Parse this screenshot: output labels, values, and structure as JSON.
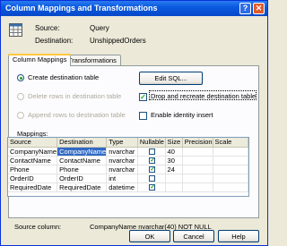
{
  "window": {
    "title": "Column Mappings and Transformations",
    "help_glyph": "?",
    "close_glyph": "✕"
  },
  "header": {
    "source_label": "Source:",
    "source_value": "Query",
    "destination_label": "Destination:",
    "destination_value": "UnshippedOrders"
  },
  "tabs": [
    {
      "label": "Column Mappings",
      "active": true
    },
    {
      "label": "Transformations",
      "active": false
    }
  ],
  "options": {
    "create_dest": "Create destination table",
    "delete_rows": "Delete rows in destination table",
    "append_rows": "Append rows to destination table",
    "edit_sql": "Edit SQL...",
    "drop_recreate": "Drop and recreate destination table",
    "enable_identity": "Enable identity insert"
  },
  "mappings_label": "Mappings:",
  "table": {
    "headers": [
      "Source",
      "Destination",
      "Type",
      "Nullable",
      "Size",
      "Precision",
      "Scale"
    ],
    "rows": [
      {
        "source": "CompanyName",
        "destination": "CompanyName",
        "type": "nvarchar",
        "nullable": false,
        "size": "40",
        "precision": "",
        "scale": ""
      },
      {
        "source": "ContactName",
        "destination": "ContactName",
        "type": "nvarchar",
        "nullable": true,
        "size": "30",
        "precision": "",
        "scale": ""
      },
      {
        "source": "Phone",
        "destination": "Phone",
        "type": "nvarchar",
        "nullable": true,
        "size": "24",
        "precision": "",
        "scale": ""
      },
      {
        "source": "OrderID",
        "destination": "OrderID",
        "type": "int",
        "nullable": false,
        "size": "",
        "precision": "",
        "scale": ""
      },
      {
        "source": "RequiredDate",
        "destination": "RequiredDate",
        "type": "datetime",
        "nullable": true,
        "size": "",
        "precision": "",
        "scale": ""
      }
    ]
  },
  "status": {
    "label": "Source column:",
    "value": "CompanyName nvarchar(40) NOT NULL"
  },
  "buttons": {
    "ok": "OK",
    "cancel": "Cancel",
    "help": "Help"
  },
  "checkmark": "✓"
}
